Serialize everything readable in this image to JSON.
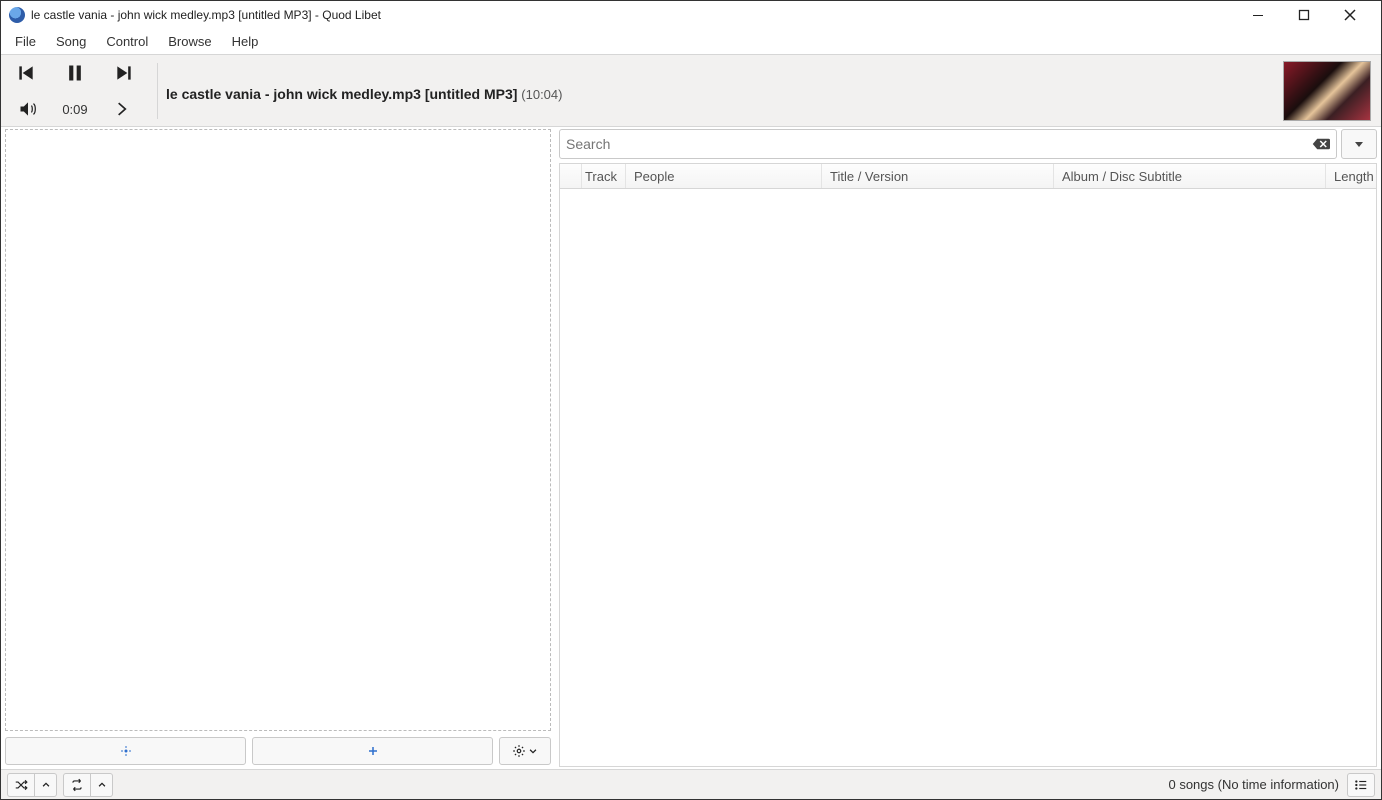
{
  "window": {
    "title": "le castle vania - john wick medley.mp3 [untitled MP3] - Quod Libet"
  },
  "menu": {
    "items": [
      "File",
      "Song",
      "Control",
      "Browse",
      "Help"
    ]
  },
  "player": {
    "track_label": "le castle vania - john wick medley.mp3 [untitled MP3]",
    "duration": "(10:04)",
    "elapsed": "0:09"
  },
  "search": {
    "placeholder": "Search"
  },
  "columns": {
    "c0": "",
    "c1": "Track",
    "c2": "People",
    "c3": "Title / Version",
    "c4": "Album / Disc Subtitle",
    "c5": "Length"
  },
  "status": {
    "text": "0 songs (No time information)"
  }
}
